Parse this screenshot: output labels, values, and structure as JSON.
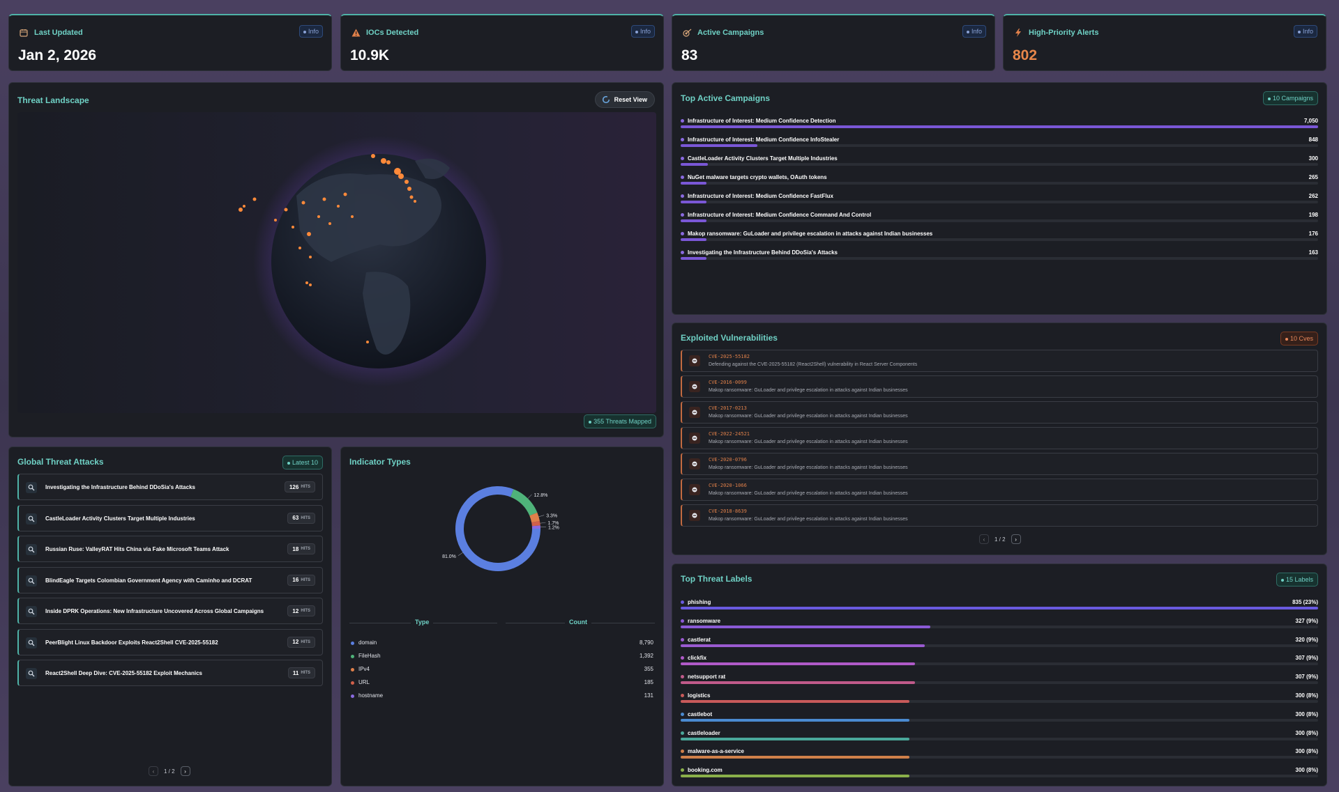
{
  "stats": [
    {
      "label": "Last Updated",
      "value": "Jan 2, 2026",
      "badge": "Info",
      "icon": "calendar-icon",
      "color": "#ffffff"
    },
    {
      "label": "IOCs Detected",
      "value": "10.9K",
      "badge": "Info",
      "icon": "warning-icon",
      "color": "#ffffff"
    },
    {
      "label": "Active Campaigns",
      "value": "83",
      "badge": "Info",
      "icon": "target-icon",
      "color": "#ffffff"
    },
    {
      "label": "High-Priority Alerts",
      "value": "802",
      "badge": "Info",
      "icon": "bolt-icon",
      "color": "#e8874a"
    }
  ],
  "landscape": {
    "title": "Threat Landscape",
    "reset_label": "Reset View",
    "mapped_badge": "355 Threats Mapped"
  },
  "campaigns": {
    "title": "Top Active Campaigns",
    "badge": "10 Campaigns",
    "items": [
      {
        "name": "Infrastructure of Interest: Medium Confidence Detection",
        "value": "7,050",
        "n": 7050
      },
      {
        "name": "Infrastructure of Interest: Medium Confidence InfoStealer",
        "value": "848",
        "n": 848
      },
      {
        "name": "CastleLoader Activity Clusters Target Multiple Industries",
        "value": "300",
        "n": 300
      },
      {
        "name": "NuGet malware targets crypto wallets, OAuth tokens",
        "value": "265",
        "n": 265
      },
      {
        "name": "Infrastructure of Interest: Medium Confidence FastFlux",
        "value": "262",
        "n": 262
      },
      {
        "name": "Infrastructure of Interest: Medium Confidence Command And Control",
        "value": "198",
        "n": 198
      },
      {
        "name": "Makop ransomware: GuLoader and privilege escalation in attacks against Indian businesses",
        "value": "176",
        "n": 176
      },
      {
        "name": "Investigating the Infrastructure Behind DDoSia's Attacks",
        "value": "163",
        "n": 163
      }
    ]
  },
  "vulns": {
    "title": "Exploited Vulnerabilities",
    "badge": "10 Cves",
    "pager": "1 / 2",
    "items": [
      {
        "id": "CVE-2025-55182",
        "desc": "Defending against the CVE-2025-55182 (React2Shell) vulnerability in React Server Components"
      },
      {
        "id": "CVE-2016-0099",
        "desc": "Makop ransomware: GuLoader and privilege escalation in attacks against Indian businesses"
      },
      {
        "id": "CVE-2017-0213",
        "desc": "Makop ransomware: GuLoader and privilege escalation in attacks against Indian businesses"
      },
      {
        "id": "CVE-2022-24521",
        "desc": "Makop ransomware: GuLoader and privilege escalation in attacks against Indian businesses"
      },
      {
        "id": "CVE-2020-0796",
        "desc": "Makop ransomware: GuLoader and privilege escalation in attacks against Indian businesses"
      },
      {
        "id": "CVE-2020-1066",
        "desc": "Makop ransomware: GuLoader and privilege escalation in attacks against Indian businesses"
      },
      {
        "id": "CVE-2018-8639",
        "desc": "Makop ransomware: GuLoader and privilege escalation in attacks against Indian businesses"
      }
    ]
  },
  "attacks": {
    "title": "Global Threat Attacks",
    "badge": "Latest 10",
    "hits_unit": "HITS",
    "pager": "1 / 2",
    "items": [
      {
        "name": "Investigating the Infrastructure Behind DDoSia's Attacks",
        "hits": "126"
      },
      {
        "name": "CastleLoader Activity Clusters Target Multiple Industries",
        "hits": "63"
      },
      {
        "name": "Russian Ruse: ValleyRAT Hits China via Fake Microsoft Teams Attack",
        "hits": "18"
      },
      {
        "name": "BlindEagle Targets Colombian Government Agency with Caminho and DCRAT",
        "hits": "16"
      },
      {
        "name": "Inside DPRK Operations: New Infrastructure Uncovered Across Global Campaigns",
        "hits": "12"
      },
      {
        "name": "PeerBlight Linux Backdoor Exploits React2Shell CVE-2025-55182",
        "hits": "12"
      },
      {
        "name": "React2Shell Deep Dive: CVE-2025-55182 Exploit Mechanics",
        "hits": "11"
      }
    ]
  },
  "indicators": {
    "title": "Indicator Types",
    "col_type": "Type",
    "col_count": "Count",
    "items": [
      {
        "type": "domain",
        "count": "8,790",
        "color": "#5b7fe0"
      },
      {
        "type": "FileHash",
        "count": "1,392",
        "color": "#4fb37a"
      },
      {
        "type": "IPv4",
        "count": "355",
        "color": "#e0804a"
      },
      {
        "type": "URL",
        "count": "185",
        "color": "#d0604a"
      },
      {
        "type": "hostname",
        "count": "131",
        "color": "#8a6ae0"
      }
    ]
  },
  "chart_data": {
    "type": "pie",
    "categories": [
      "domain",
      "FileHash",
      "IPv4",
      "URL",
      "hostname"
    ],
    "values": [
      81.0,
      12.8,
      3.3,
      1.7,
      1.2
    ],
    "value_labels": [
      "81.0%",
      "12.8%",
      "3.3%",
      "1.7%",
      "1.2%"
    ],
    "colors": [
      "#5b7fe0",
      "#4fb37a",
      "#e0804a",
      "#d0604a",
      "#8a6ae0"
    ]
  },
  "labels": {
    "title": "Top Threat Labels",
    "badge": "15 Labels",
    "items": [
      {
        "name": "phishing",
        "value": "835 (23%)",
        "n": 835,
        "color": "#6a5ae0"
      },
      {
        "name": "ransomware",
        "value": "327 (9%)",
        "n": 327,
        "color": "#8a5ad6"
      },
      {
        "name": "castlerat",
        "value": "320 (9%)",
        "n": 320,
        "color": "#9a5ad0"
      },
      {
        "name": "clickfix",
        "value": "307 (9%)",
        "n": 307,
        "color": "#b05ac8"
      },
      {
        "name": "netsupport rat",
        "value": "307 (9%)",
        "n": 307,
        "color": "#c05a8a"
      },
      {
        "name": "logistics",
        "value": "300 (8%)",
        "n": 300,
        "color": "#c85a5a"
      },
      {
        "name": "castlebot",
        "value": "300 (8%)",
        "n": 300,
        "color": "#4a8ad0"
      },
      {
        "name": "castleloader",
        "value": "300 (8%)",
        "n": 300,
        "color": "#4aa89a"
      },
      {
        "name": "malware-as-a-service",
        "value": "300 (8%)",
        "n": 300,
        "color": "#d0804a"
      },
      {
        "name": "booking.com",
        "value": "300 (8%)",
        "n": 300,
        "color": "#8ab04a"
      }
    ]
  }
}
